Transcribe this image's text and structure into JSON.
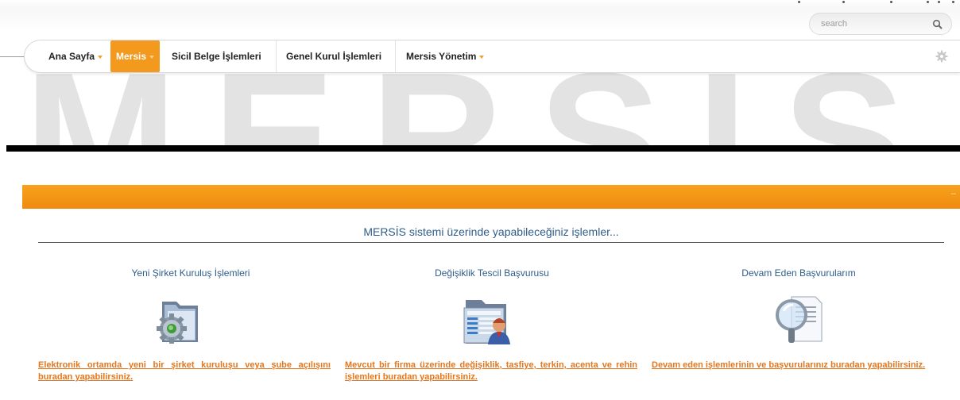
{
  "watermark": "MERSIS",
  "search": {
    "placeholder": "search"
  },
  "nav": {
    "items": [
      {
        "label": "Ana Sayfa",
        "dropdown": true
      },
      {
        "label": "Mersis",
        "dropdown": true,
        "active": true
      },
      {
        "label": "Sicil Belge İşlemleri",
        "dropdown": false
      },
      {
        "label": "Genel Kurul İşlemleri",
        "dropdown": false
      },
      {
        "label": "Mersis Yönetim",
        "dropdown": true
      }
    ]
  },
  "panel": {
    "collapse_label": "–",
    "heading": "MERSİS sistemi üzerinde yapabileceğiniz işlemler...",
    "cards": [
      {
        "title": "Yeni Şirket Kuruluş İşlemleri",
        "icon": "folder-gear-icon",
        "description": "Elektronik ortamda yeni bir şirket kuruluşu veya şube açılışını buradan yapabilirsiniz."
      },
      {
        "title": "Değişiklik Tescil Başvurusu",
        "icon": "folder-user-icon",
        "description": "Mevcut bir firma üzerinde değişiklik, tasfiye, terkin, acenta ve rehin işlemleri buradan yapabilirsiniz."
      },
      {
        "title": "Devam Eden Başvurularım",
        "icon": "magnifier-document-icon",
        "description": "Devam eden işlemlerinin ve başvurularınız buradan yapabilirsiniz."
      }
    ]
  },
  "colors": {
    "accent": "#f39a1e",
    "link": "#e6761c",
    "heading": "#2f5d8a"
  }
}
